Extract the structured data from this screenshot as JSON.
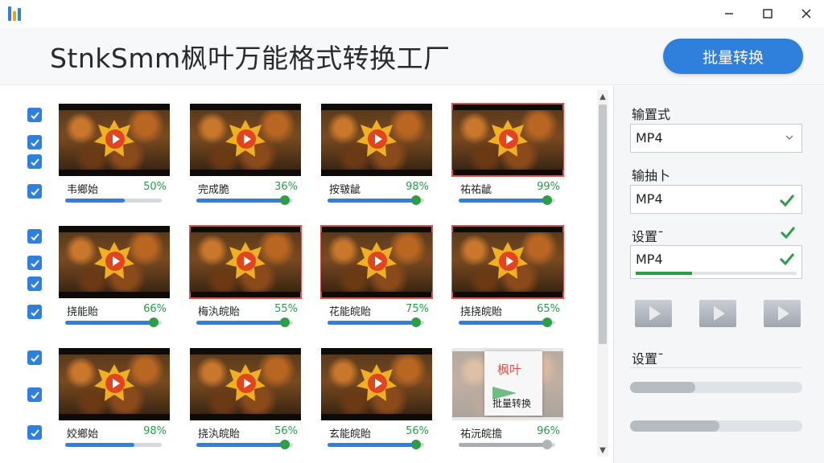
{
  "window": {
    "minimize_label": "minimize",
    "maximize_label": "maximize",
    "close_label": "close"
  },
  "header": {
    "title": "StnkSmm枫叶万能格式转换工厂",
    "batch_button": "批量转换"
  },
  "videos": [
    {
      "label": "韦鄉始",
      "percent": "50%",
      "progress": 0.62,
      "knob": false
    },
    {
      "label": "完成脆",
      "percent": "36%",
      "progress": 0.92,
      "knob": true
    },
    {
      "label": "按皲龇",
      "percent": "98%",
      "progress": 0.92,
      "knob": true
    },
    {
      "label": "祐祐龇",
      "percent": "99%",
      "progress": 0.92,
      "knob": true
    },
    {
      "label": "挠能貽",
      "percent": "66%",
      "progress": 0.92,
      "knob": true
    },
    {
      "label": "梅汍皖貽",
      "percent": "55%",
      "progress": 0.92,
      "knob": true
    },
    {
      "label": "花能皖貽",
      "percent": "75%",
      "progress": 0.92,
      "knob": true
    },
    {
      "label": "挠挠皖貽",
      "percent": "65%",
      "progress": 0.92,
      "knob": true
    },
    {
      "label": "姣鄉始",
      "percent": "98%",
      "progress": 0.72,
      "knob": false
    },
    {
      "label": "挠汍皖貽",
      "percent": "56%",
      "progress": 0.92,
      "knob": true
    },
    {
      "label": "玄能皖貽",
      "percent": "56%",
      "progress": 0.92,
      "knob": true
    },
    {
      "label": "祐沅皖擔",
      "percent": "96%",
      "progress": 0.92,
      "knob": true
    }
  ],
  "special_thumb": {
    "title": "枫叶",
    "subtitle": "批量转换"
  },
  "side": {
    "format_label": "输置式",
    "format_value": "MP4",
    "output_label": "输抽卜",
    "output_value": "MP4",
    "settings_label": "设置¯",
    "settings_value": "MP4",
    "settings_progress": 0.35,
    "settings2_label": "设置¯",
    "slider1_value": 0.38,
    "slider2_value": 0.52
  },
  "colors": {
    "accent": "#2f7fdc",
    "success": "#2e9d48",
    "danger": "#d9534f"
  },
  "icons": {
    "checkbox": "check-icon",
    "play": "play-icon",
    "dropdown": "chevron-down-icon",
    "done": "green-check-icon"
  }
}
